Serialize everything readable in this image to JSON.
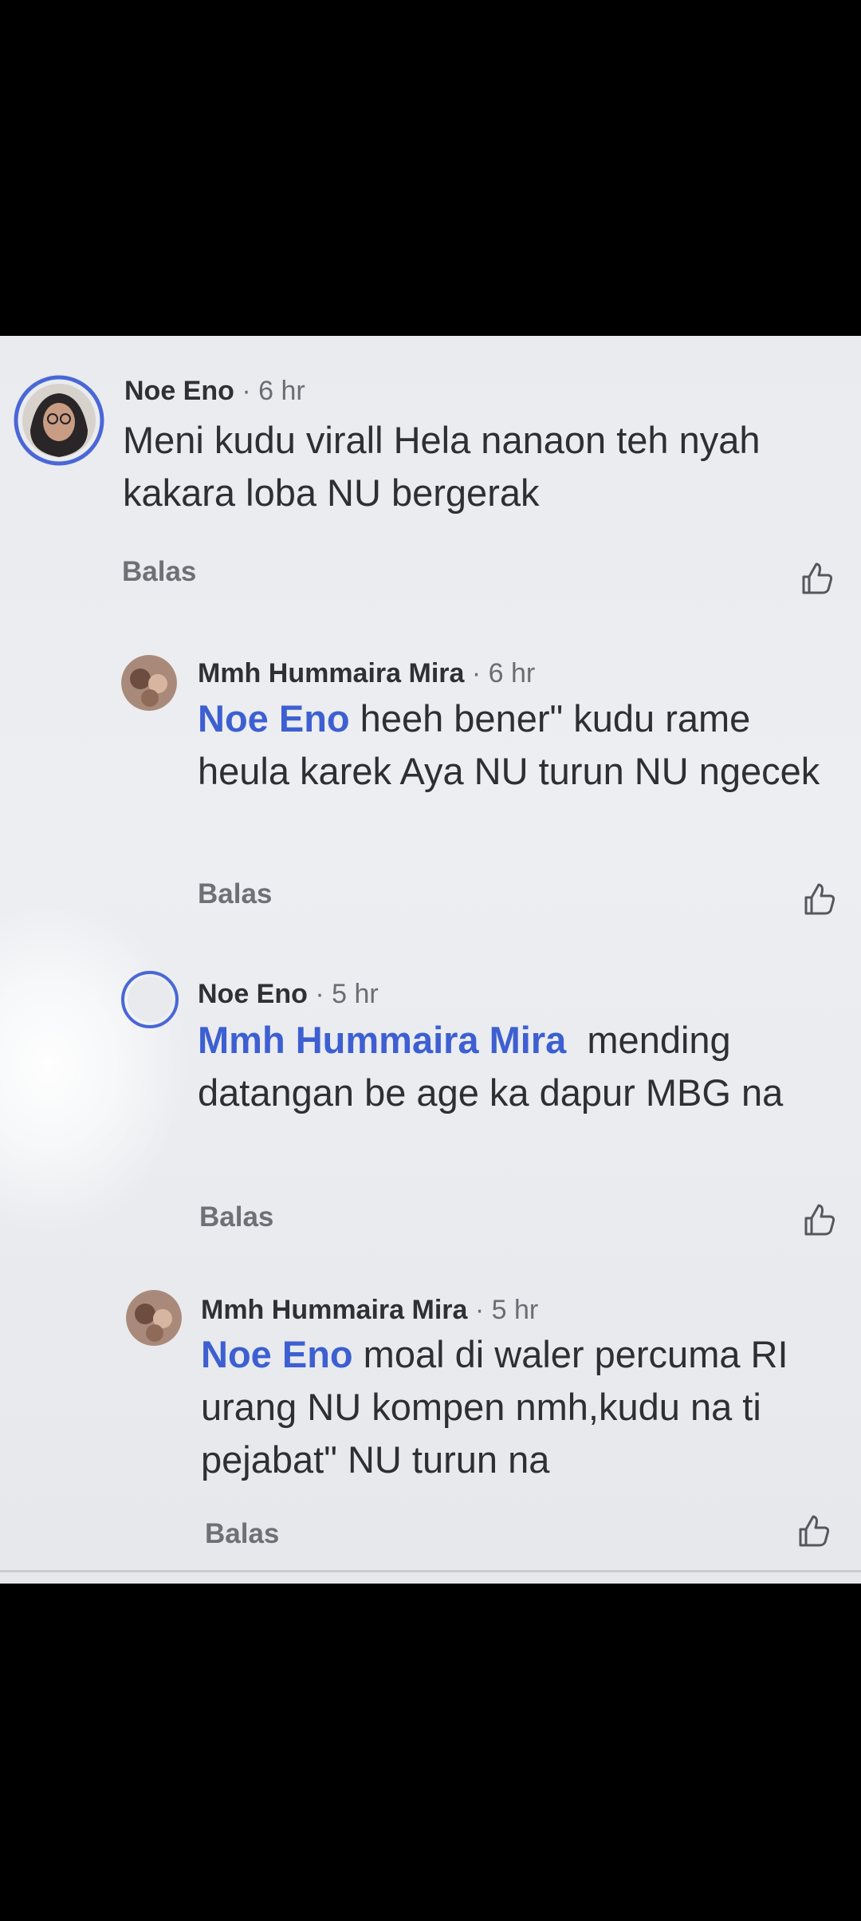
{
  "comments": [
    {
      "author": "Noe Eno",
      "separator": " · ",
      "time": "6 hr",
      "mention": "",
      "text": "Meni kudu virall Hela nanaon teh nyah kakara loba NU bergerak",
      "reply_label": "Balas",
      "like_icon": "thumbs-up-icon"
    },
    {
      "author": "Mmh Hummaira Mira",
      "separator": " · ",
      "time": "6 hr",
      "mention": "Noe Eno",
      "text": " heeh bener\" kudu rame heula karek Aya NU turun NU ngecek",
      "reply_label": "Balas",
      "like_icon": "thumbs-up-icon"
    },
    {
      "author": "Noe Eno",
      "separator": " · ",
      "time": "5 hr",
      "mention": "Mmh Hummaira Mira",
      "text": "  mending datangan be age ka dapur MBG na",
      "reply_label": "Balas",
      "like_icon": "thumbs-up-icon"
    },
    {
      "author": "Mmh Hummaira Mira",
      "separator": " · ",
      "time": "5 hr",
      "mention": "Noe Eno",
      "text": " moal di waler percuma RI urang NU kompen nmh,kudu na ti pejabat\" NU turun na",
      "reply_label": "Balas",
      "like_icon": "thumbs-up-icon"
    }
  ],
  "colors": {
    "mention": "#3d5fd1",
    "story_ring": "#4a67d6",
    "background": "#eceef2"
  }
}
